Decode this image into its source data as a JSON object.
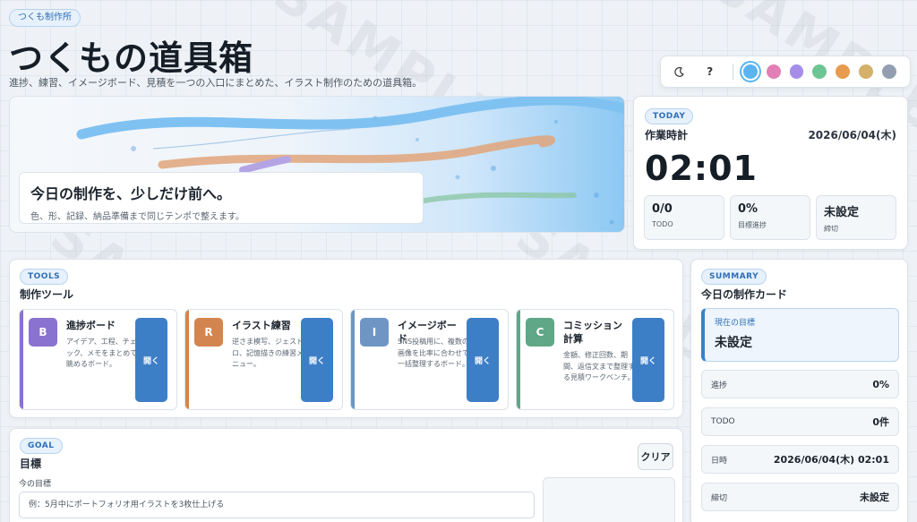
{
  "header": {
    "brand": "つくも制作所",
    "title": "つくもの道具箱",
    "subtitle": "進捗、練習、イメージボード、見積を一つの入口にまとめた、イラスト制作のための道具箱。"
  },
  "toolbar": {
    "theme_icon": "moon-icon",
    "help_label": "?",
    "swatches": [
      {
        "name": "blue",
        "color": "#5bb4f0",
        "active": true
      },
      {
        "name": "pink",
        "color": "#e37fb5"
      },
      {
        "name": "purple",
        "color": "#a58ee8"
      },
      {
        "name": "green",
        "color": "#6cc592"
      },
      {
        "name": "orange",
        "color": "#e89a4e"
      },
      {
        "name": "gold",
        "color": "#d4b06a"
      },
      {
        "name": "gray",
        "color": "#939fb0"
      }
    ]
  },
  "hero": {
    "title": "今日の制作を、少しだけ前へ。",
    "desc": "色、形、記録、納品準備まで同じテンポで整えます。"
  },
  "today": {
    "tag": "TODAY",
    "title": "作業時計",
    "date": "2026/06/04(木)",
    "clock": "02:01",
    "stats": [
      {
        "value": "0/0",
        "label": "TODO"
      },
      {
        "value": "0%",
        "label": "目標進捗"
      },
      {
        "value": "未設定",
        "label": "締切"
      }
    ]
  },
  "tools": {
    "tag": "TOOLS",
    "title": "制作ツール",
    "open_label": "開く",
    "items": [
      {
        "letter": "B",
        "name": "進捗ボード",
        "desc": "アイデア、工程、チェック、メモをまとめて眺めるボード。",
        "color": "#8a72d0"
      },
      {
        "letter": "R",
        "name": "イラスト練習",
        "desc": "逆さま模写、ジェスドロ、記憶描きの練習メニュー。",
        "color": "#d38550"
      },
      {
        "letter": "I",
        "name": "イメージボード",
        "desc": "SNS投稿用に、複数の画像を比率に合わせて一括整理するボード。",
        "color": "#6e95c4"
      },
      {
        "letter": "C",
        "name": "コミッション計算",
        "desc": "金額、修正回数、期間、返信文まで整理する見積ワークベンチ。",
        "color": "#5fa786"
      }
    ]
  },
  "summary": {
    "tag": "SUMMARY",
    "title": "今日の制作カード",
    "goal_label": "現在の目標",
    "goal_value": "未設定",
    "rows": [
      {
        "label": "進捗",
        "value": "0%"
      },
      {
        "label": "TODO",
        "value": "0件"
      },
      {
        "label": "日時",
        "value": "2026/06/04(木) 02:01"
      },
      {
        "label": "締切",
        "value": "未設定"
      }
    ]
  },
  "goal": {
    "tag": "GOAL",
    "title": "目標",
    "clear_label": "クリア",
    "field_label": "今の目標",
    "placeholder": "例：5月中にポートフォリオ用イラストを3枚仕上げる"
  },
  "watermark": "SAMPLE"
}
